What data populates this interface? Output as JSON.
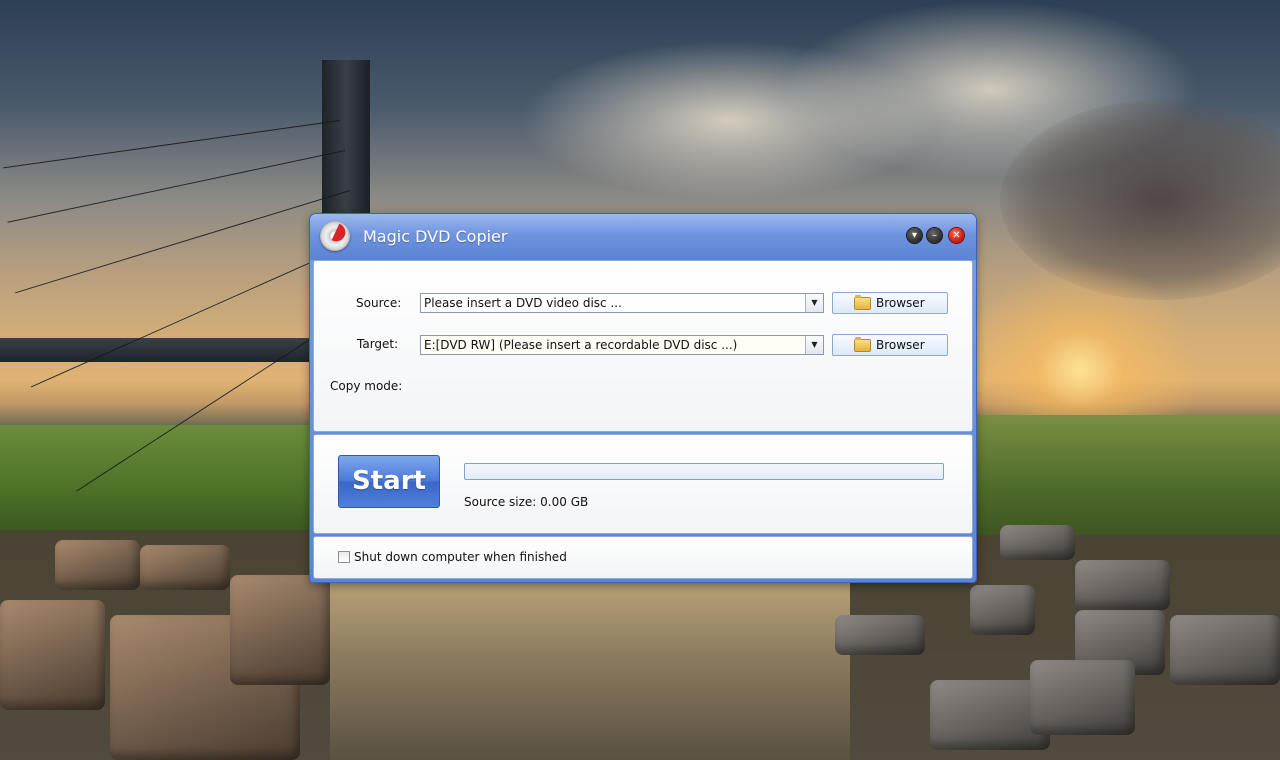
{
  "window": {
    "title": "Magic DVD Copier",
    "icon": "dvd-disc-icon",
    "controls": {
      "menu": "▾",
      "minimize": "–",
      "close": "✕"
    }
  },
  "source": {
    "label": "Source:",
    "value": "Please insert a DVD video disc ...",
    "browse_label": "Browser"
  },
  "target": {
    "label": "Target:",
    "value": "E:[DVD RW] (Please insert a recordable DVD disc ...)",
    "browse_label": "Browser"
  },
  "copy_mode": {
    "label": "Copy mode:"
  },
  "actions": {
    "start_label": "Start",
    "progress_fraction": 0,
    "source_size": "Source size: 0.00 GB"
  },
  "options": {
    "shutdown_label": "Shut down computer when finished",
    "shutdown_checked": false
  },
  "colors": {
    "titlebar": "#6f93de",
    "start_button": "#4c7ad8",
    "close_button": "#c4150c"
  }
}
